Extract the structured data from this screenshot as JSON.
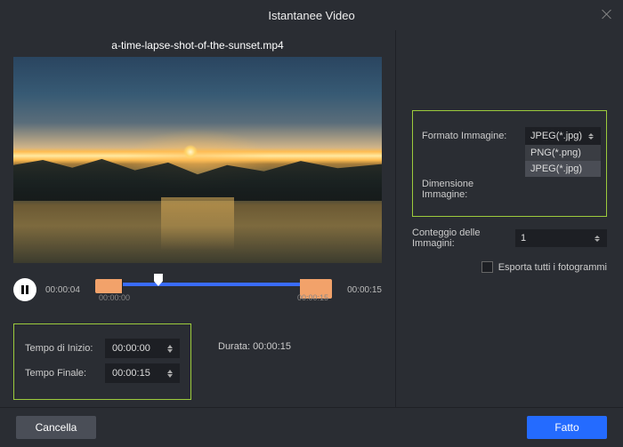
{
  "title": "Istantanee Video",
  "filename": "a-time-lapse-shot-of-the-sunset.mp4",
  "transport": {
    "current_time": "00:00:04",
    "total_time": "00:00:15",
    "tick_start": "00:00:00",
    "tick_end": "00:00:15"
  },
  "time_box": {
    "start_label": "Tempo di Inizio:",
    "start_value": "00:00:00",
    "end_label": "Tempo Finale:",
    "end_value": "00:00:15"
  },
  "duration": {
    "label": "Durata:",
    "value": "00:00:15"
  },
  "right": {
    "format_label": "Formato Immagine:",
    "format_value": "JPEG(*.jpg)",
    "format_options": [
      "PNG(*.png)",
      "JPEG(*.jpg)"
    ],
    "size_label": "Dimensione Immagine:",
    "count_label": "Conteggio delle Immagini:",
    "count_value": "1",
    "export_all_label": "Esporta tutti i fotogrammi"
  },
  "footer": {
    "cancel": "Cancella",
    "done": "Fatto"
  }
}
